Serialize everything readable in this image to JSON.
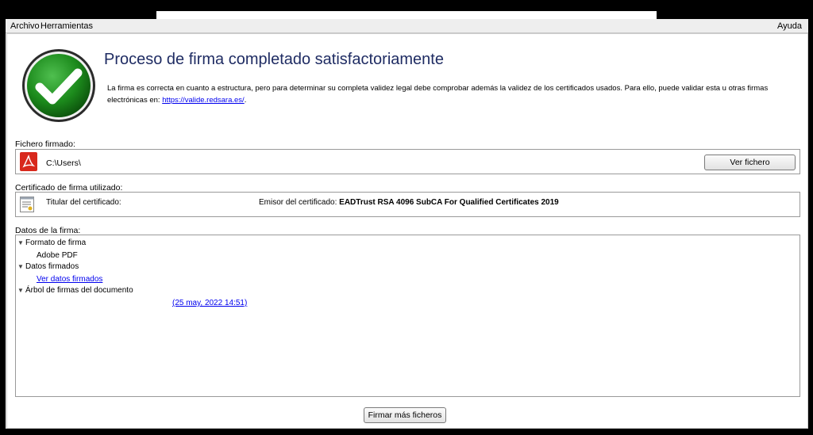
{
  "menubar": {
    "archivo": "Archivo",
    "herramientas": "Herramientas",
    "ayuda": "Ayuda"
  },
  "header": {
    "title": "Proceso de firma completado satisfactoriamente",
    "description": "La firma es correcta en cuanto a estructura, pero para determinar su completa validez legal debe comprobar además la validez de los certificados usados. Para ello, puede validar esta u otras firmas electrónicas en: ",
    "link": "https://valide.redsara.es/",
    "link_suffix": "."
  },
  "file": {
    "label": "Fichero firmado:",
    "path": "C:\\Users\\",
    "view_button": "Ver fichero"
  },
  "certificate": {
    "label": "Certificado de firma utilizado:",
    "titular_label": "Titular del certificado:",
    "emisor_label": "Emisor del certificado: ",
    "emisor_value": "EADTrust RSA 4096 SubCA For Qualified Certificates 2019"
  },
  "signature_data": {
    "label": "Datos de la firma:",
    "format_heading": "Formato de firma",
    "format_value": "Adobe PDF",
    "signed_data_heading": "Datos firmados",
    "signed_data_link": "Ver datos firmados",
    "tree_heading": "Árbol de firmas del documento",
    "tree_entry": "(25 may, 2022 14:51)"
  },
  "footer": {
    "sign_more_button": "Firmar más ficheros"
  },
  "colors": {
    "title": "#1f2c63",
    "check_green": "#1c8a1c",
    "link": "#0000ee"
  }
}
